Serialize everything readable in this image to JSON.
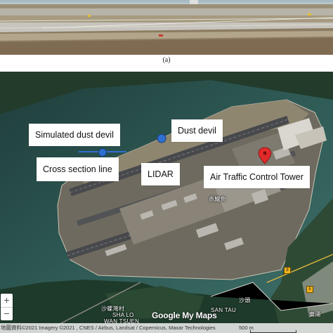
{
  "figure": {
    "caption": "(a)"
  },
  "map": {
    "labels": {
      "simulated_dust_devil": "Simulated dust devil",
      "dust_devil": "Dust devil",
      "cross_section_line": "Cross section line",
      "lidar": "LIDAR",
      "air_traffic_control_tower": "Air Traffic Control Tower"
    },
    "place_names": {
      "chek_lap_kok": "赤鱲角",
      "sha_lo_chinese": "沙螺灣村",
      "sha_lo_english_1": "SHA LO",
      "sha_lo_english_2": "WAN TSUEN",
      "san_tau": "SAN TAU",
      "san_tau_chinese": "沙頭",
      "tung_chung": "東涌",
      "road_1": "8",
      "road_2": "8"
    },
    "controls": {
      "zoom_in": "+",
      "zoom_out": "−"
    },
    "logo": "Google My Maps",
    "attribution": "地圖資料©2021 Imagery ©2021 , CNES / Airbus, Landsat / Copernicus, Maxar Technologies",
    "scale": "500 m",
    "colors": {
      "water": "#2f5a55",
      "land_green": "#2d4a34",
      "runway": "#4b4d50",
      "airport_land": "#7a7568",
      "marker_blue": "#2f6fd0",
      "pin_red": "#e02a2a"
    }
  }
}
